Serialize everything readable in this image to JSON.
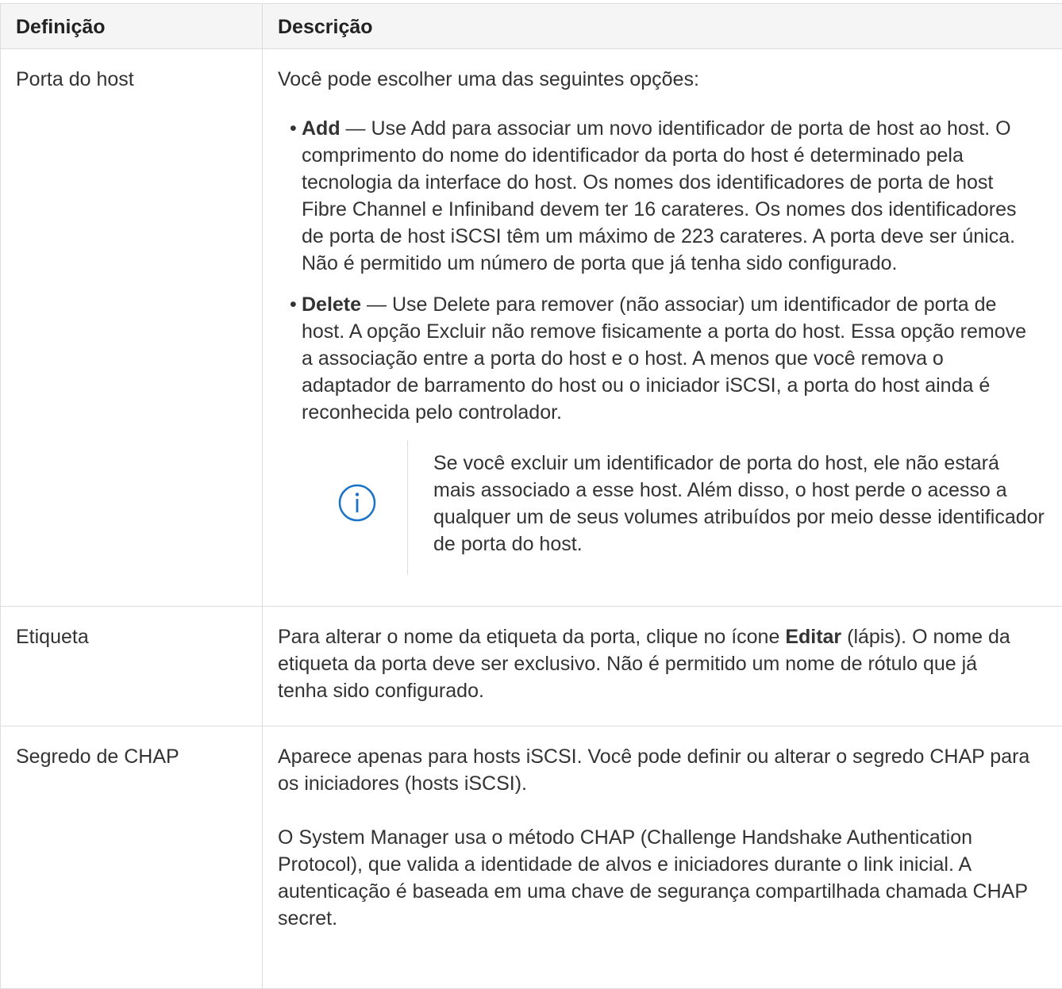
{
  "table": {
    "header": {
      "definition": "Definição",
      "description": "Descrição"
    },
    "rows": [
      {
        "term": "Porta do host",
        "intro": "Você pode escolher uma das seguintes opções:",
        "options": [
          {
            "bullet": "•",
            "name": "Add",
            "dash": " — ",
            "text": "Use Add para associar um novo identificador de porta de host ao host. O comprimento do nome do identificador da porta do host é determinado pela tecnologia da interface do host. Os nomes dos identificadores de porta de host Fibre Channel e Infiniband devem ter 16 carateres. Os nomes dos identificadores de porta de host iSCSI têm um máximo de 223 carateres. A porta deve ser única. Não é permitido um número de porta que já tenha sido configurado."
          },
          {
            "bullet": "•",
            "name": "Delete",
            "dash": " — ",
            "text": "Use Delete para remover (não associar) um identificador de porta de host. A opção Excluir não remove fisicamente a porta do host. Essa opção remove a associação entre a porta do host e o host. A menos que você remova o adaptador de barramento do host ou o iniciador iSCSI, a porta do host ainda é reconhecida pelo controlador."
          }
        ],
        "note": {
          "icon": "info-icon",
          "text": "Se você excluir um identificador de porta do host, ele não estará mais associado a esse host. Além disso, o host perde o acesso a qualquer um de seus volumes atribuídos por meio desse identificador de porta do host."
        }
      },
      {
        "term": "Etiqueta",
        "before": "Para alterar o nome da etiqueta da porta, clique no ícone ",
        "bold": "Editar",
        "after": " (lápis). O nome da etiqueta da porta deve ser exclusivo. Não é permitido um nome de rótulo que já tenha sido configurado."
      },
      {
        "term": "Segredo de CHAP",
        "para1": "Aparece apenas para hosts iSCSI. Você pode definir ou alterar o segredo CHAP para os iniciadores (hosts iSCSI).",
        "para2": "O System Manager usa o método CHAP (Challenge Handshake Authentication Protocol), que valida a identidade de alvos e iniciadores durante o link inicial. A autenticação é baseada em uma chave de segurança compartilhada chamada CHAP secret."
      }
    ],
    "colors": {
      "border": "#dddddd",
      "header_bg": "#f5f5f5",
      "text": "#333333",
      "info_icon": "#1a73c8"
    }
  }
}
